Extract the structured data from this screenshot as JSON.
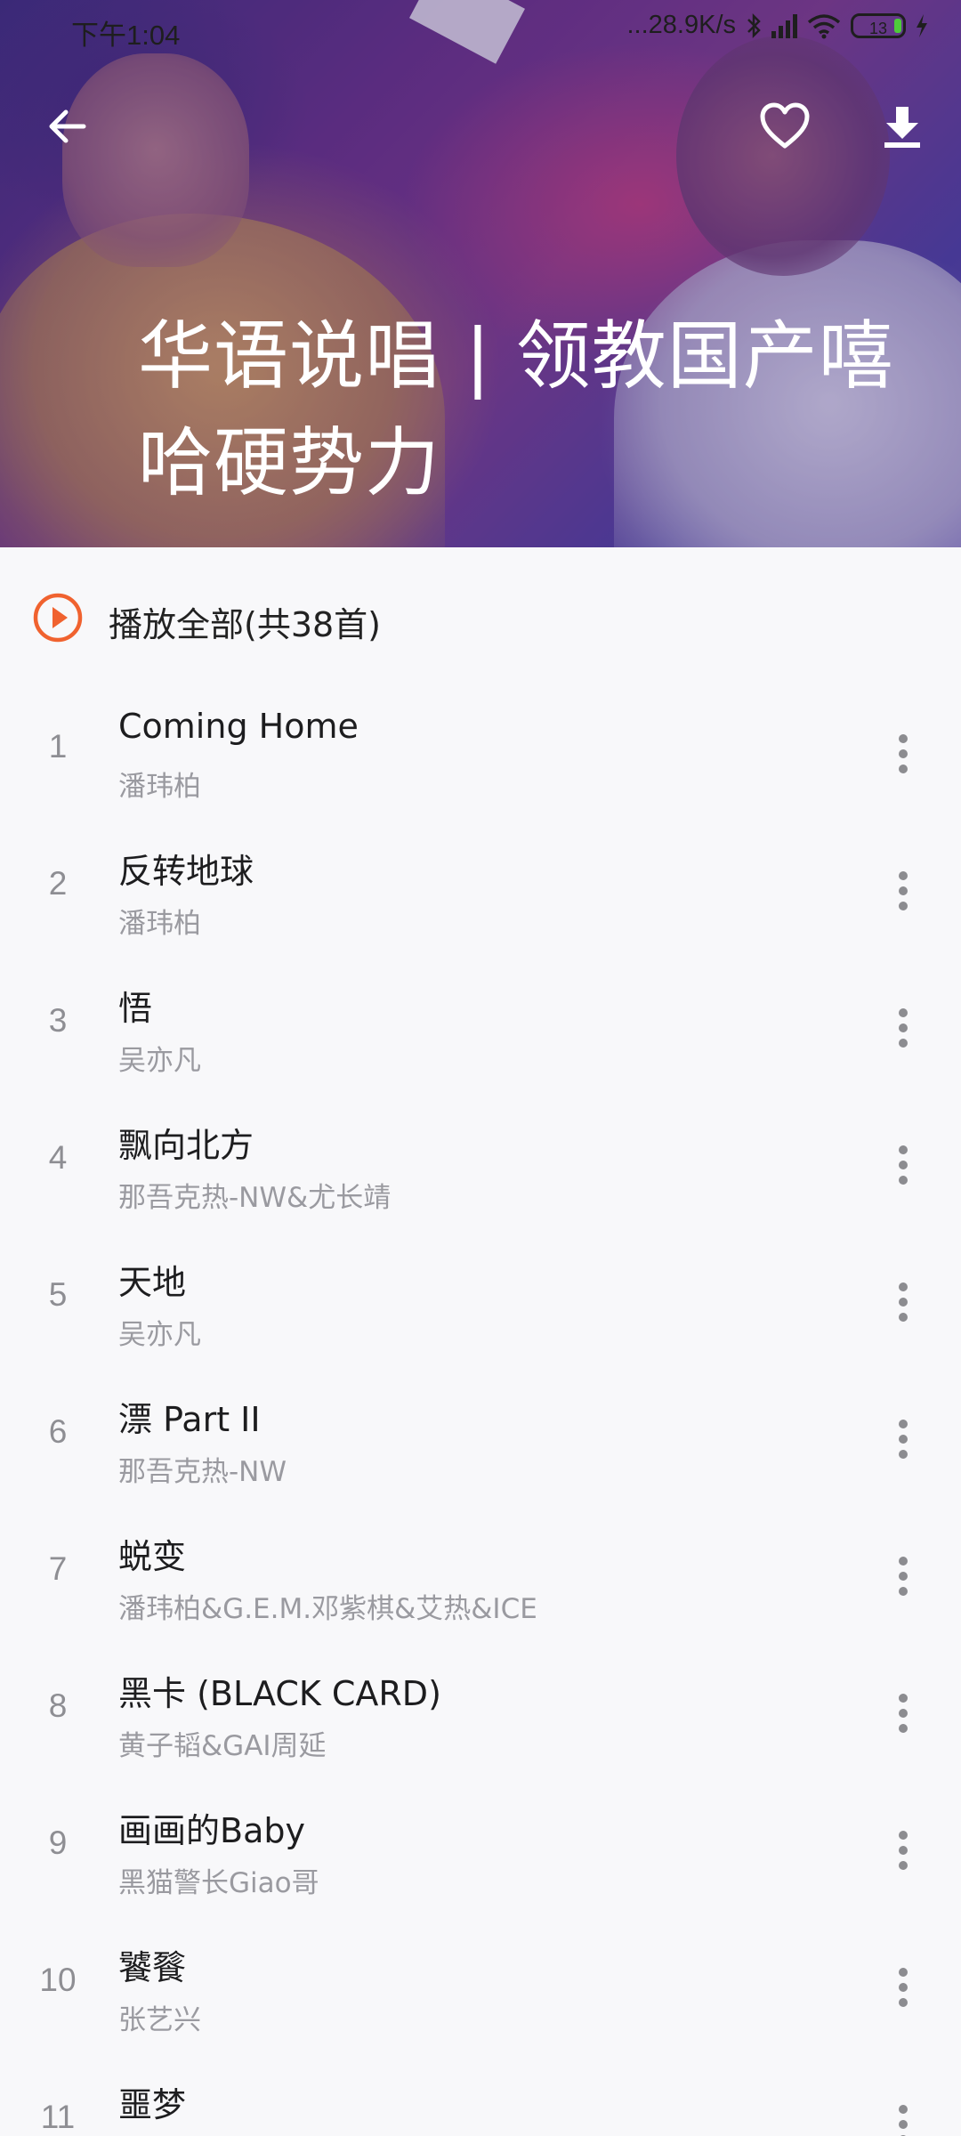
{
  "status": {
    "time": "下午1:04",
    "network_speed": "...28.9K/s",
    "battery": "13"
  },
  "header": {
    "title": "华语说唱 | 领教国产嘻哈硬势力"
  },
  "play_all": {
    "label": "播放全部(共38首)"
  },
  "songs": [
    {
      "index": "1",
      "title": "Coming Home",
      "artist": "潘玮柏"
    },
    {
      "index": "2",
      "title": "反转地球",
      "artist": "潘玮柏"
    },
    {
      "index": "3",
      "title": "悟",
      "artist": "吴亦凡"
    },
    {
      "index": "4",
      "title": "飘向北方",
      "artist": "那吾克热-NW&尤长靖"
    },
    {
      "index": "5",
      "title": "天地",
      "artist": "吴亦凡"
    },
    {
      "index": "6",
      "title": "漂 Part II",
      "artist": "那吾克热-NW"
    },
    {
      "index": "7",
      "title": "蜕变",
      "artist": "潘玮柏&G.E.M.邓紫棋&艾热&ICE"
    },
    {
      "index": "8",
      "title": "黑卡 (BLACK CARD)",
      "artist": "黄子韬&GAI周延"
    },
    {
      "index": "9",
      "title": "画画的Baby",
      "artist": "黑猫警长Giao哥"
    },
    {
      "index": "10",
      "title": "饕餮",
      "artist": "张艺兴"
    },
    {
      "index": "11",
      "title": "噩梦",
      "artist": ""
    }
  ],
  "colors": {
    "accent": "#f0622f",
    "background": "#f8f8fa"
  }
}
